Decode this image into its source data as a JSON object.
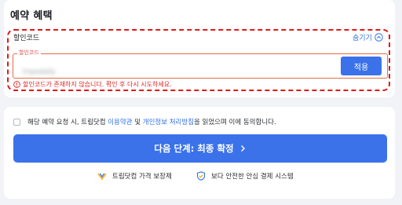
{
  "benefits": {
    "title": "예약 혜택",
    "code_label": "할인코드",
    "collapse_label": "숨기기",
    "field_legend": "할인코드",
    "field_value": "tripsdaily",
    "apply_label": "적용",
    "error_text": "할인코드가 존재하지 않습니다. 확인 후 다시 시도하세요."
  },
  "agreement": {
    "prefix": "해당 예약 요청 시, 트립닷컴",
    "terms_link": "이용약관",
    "and": "및",
    "privacy_link": "개인정보 처리방침",
    "suffix": "을 읽었으며 이에 동의합니다."
  },
  "next_button": {
    "label": "다음 단계: 최종 확정"
  },
  "guarantees": {
    "price": "트립닷컴 가격 보장제",
    "payment": "보다 안전한 안심 결제 시스템"
  },
  "colors": {
    "accent": "#3b72ea",
    "error": "#e02424",
    "highlight_border": "#e01919"
  }
}
